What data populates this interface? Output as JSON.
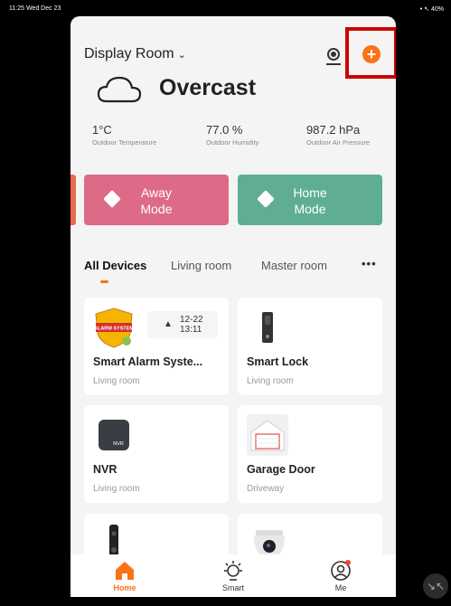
{
  "status_bar": {
    "time": "11:25",
    "date": "Wed Dec 23",
    "right": "• ↖ 40%"
  },
  "header": {
    "room": "Display Room",
    "weather": "Overcast"
  },
  "stats": [
    {
      "value": "1°C",
      "label": "Outdoor Temperature"
    },
    {
      "value": "77.0 %",
      "label": "Outdoor Humidity"
    },
    {
      "value": "987.2 hPa",
      "label": "Outdoor Air Pressure"
    }
  ],
  "modes": {
    "away": {
      "line1": "Away",
      "line2": "Mode"
    },
    "home": {
      "line1": "Home",
      "line2": "Mode"
    }
  },
  "tabs": [
    "All Devices",
    "Living room",
    "Master room"
  ],
  "devices": [
    {
      "name": "Smart Alarm Syste...",
      "room": "Living room",
      "alert_date": "12-22",
      "alert_time": "13:11",
      "badge_text": "ALARM SYSTEM"
    },
    {
      "name": "Smart Lock",
      "room": "Living room"
    },
    {
      "name": "NVR",
      "room": "Living room",
      "icon_text": "NVR"
    },
    {
      "name": "Garage Door",
      "room": "Driveway"
    }
  ],
  "nav": [
    {
      "label": "Home"
    },
    {
      "label": "Smart"
    },
    {
      "label": "Me"
    }
  ],
  "colors": {
    "accent": "#f97316",
    "away": "#dd6b87",
    "home": "#5fae92",
    "highlight": "#cc0000"
  }
}
